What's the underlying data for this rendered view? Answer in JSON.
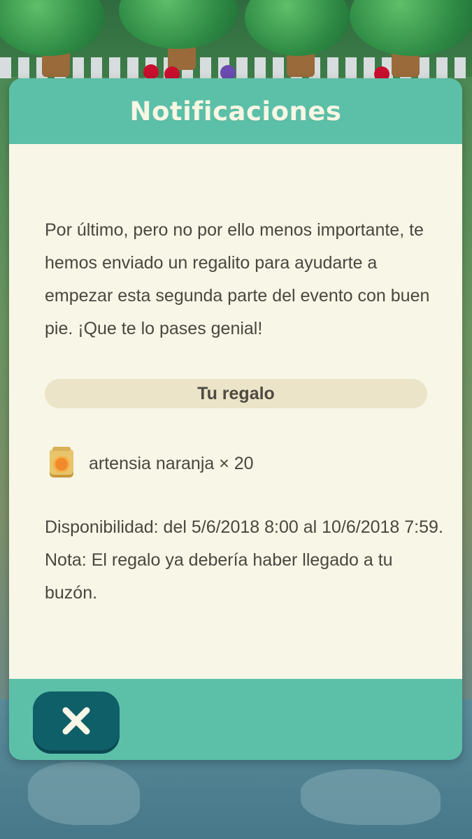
{
  "dialog": {
    "title": "Notificaciones",
    "message": "Por último, pero no por ello menos importante, te hemos enviado un regalito para ayudarte a empezar esta segunda parte del evento con buen pie. ¡Que te lo pases genial!",
    "gift_banner": "Tu regalo",
    "gift_item": {
      "icon": "seed-bag-icon",
      "label": "artensia naranja × 20"
    },
    "availability": "Disponibilidad: del 5/6/2018 8:00 al 10/6/2018 7:59.",
    "note": "Nota: El regalo ya debería haber llegado a tu buzón.",
    "close_icon": "close-icon"
  },
  "colors": {
    "header": "#5cc0a8",
    "body": "#f8f6e6",
    "banner": "#ece4c8",
    "close_button": "#0f5f68"
  }
}
